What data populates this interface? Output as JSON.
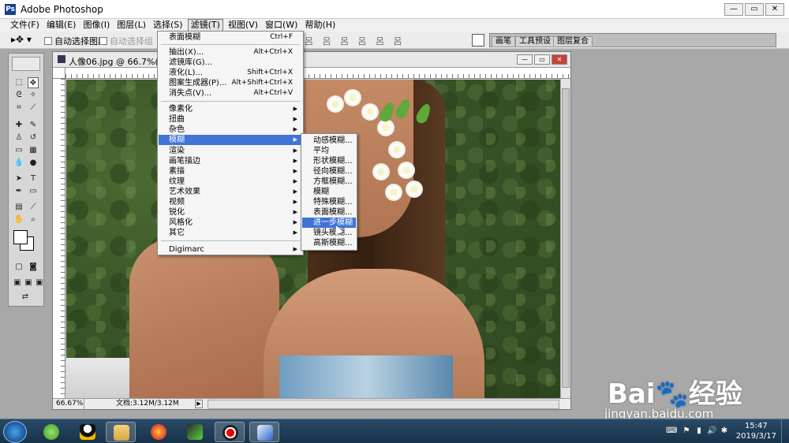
{
  "app": {
    "title": "Adobe Photoshop",
    "icon": "photoshop-icon"
  },
  "window_controls": {
    "minimize": "—",
    "restore": "▭",
    "close": "✕"
  },
  "menubar": {
    "items": [
      {
        "label": "文件(F)"
      },
      {
        "label": "编辑(E)"
      },
      {
        "label": "图像(I)"
      },
      {
        "label": "图层(L)"
      },
      {
        "label": "选择(S)"
      },
      {
        "label": "滤镜(T)"
      },
      {
        "label": "视图(V)"
      },
      {
        "label": "窗口(W)"
      },
      {
        "label": "帮助(H)"
      }
    ],
    "active_index": 5
  },
  "options": {
    "move_tool": "▸✥ ▾",
    "auto_select_layer": "自动选择图层",
    "show_bounding_box": "自动选择组",
    "align_icons": "呂 呂 呂 呂 呂 呂",
    "well_tabs": [
      "画笔",
      "工具预设",
      "图层复合"
    ]
  },
  "document": {
    "title": "人像06.jpg @ 66.7%(RGB/8",
    "zoom": "66.67%",
    "doc_size": "文档:3.12M/3.12M",
    "arrow": "▶"
  },
  "filter_menu": {
    "items": [
      {
        "label": "表面模糊",
        "shortcut": "Ctrl+F"
      },
      {
        "label": "抽出(X)...",
        "shortcut": "Alt+Ctrl+X"
      },
      {
        "label": "滤镜库(G)...",
        "shortcut": ""
      },
      {
        "label": "液化(L)...",
        "shortcut": "Shift+Ctrl+X"
      },
      {
        "label": "图案生成器(P)...",
        "shortcut": "Alt+Shift+Ctrl+X"
      },
      {
        "label": "消失点(V)...",
        "shortcut": "Alt+Ctrl+V"
      },
      {
        "label": "像素化",
        "submenu": true
      },
      {
        "label": "扭曲",
        "submenu": true
      },
      {
        "label": "杂色",
        "submenu": true
      },
      {
        "label": "模糊",
        "submenu": true,
        "highlighted": true
      },
      {
        "label": "渲染",
        "submenu": true
      },
      {
        "label": "画笔描边",
        "submenu": true
      },
      {
        "label": "素描",
        "submenu": true
      },
      {
        "label": "纹理",
        "submenu": true
      },
      {
        "label": "艺术效果",
        "submenu": true
      },
      {
        "label": "视频",
        "submenu": true
      },
      {
        "label": "锐化",
        "submenu": true
      },
      {
        "label": "风格化",
        "submenu": true
      },
      {
        "label": "其它",
        "submenu": true
      },
      {
        "label": "Digimarc",
        "submenu": true
      }
    ]
  },
  "blur_submenu": {
    "items": [
      {
        "label": "动感模糊..."
      },
      {
        "label": "平均"
      },
      {
        "label": "形状模糊..."
      },
      {
        "label": "径向模糊..."
      },
      {
        "label": "方框模糊..."
      },
      {
        "label": "模糊"
      },
      {
        "label": "特殊模糊..."
      },
      {
        "label": "表面模糊..."
      },
      {
        "label": "进一步模糊",
        "highlighted": true
      },
      {
        "label": "镜头模糊..."
      },
      {
        "label": "高斯模糊..."
      }
    ]
  },
  "watermark": {
    "brand": "Bai🐾经验",
    "url": "jingyan.baidu.com"
  },
  "taskbar": {
    "clock_time": "15:47",
    "clock_date": "2019/3/17"
  },
  "colors": {
    "menu_highlight": "#3f74d6",
    "taskbar": "#1e3a56"
  }
}
